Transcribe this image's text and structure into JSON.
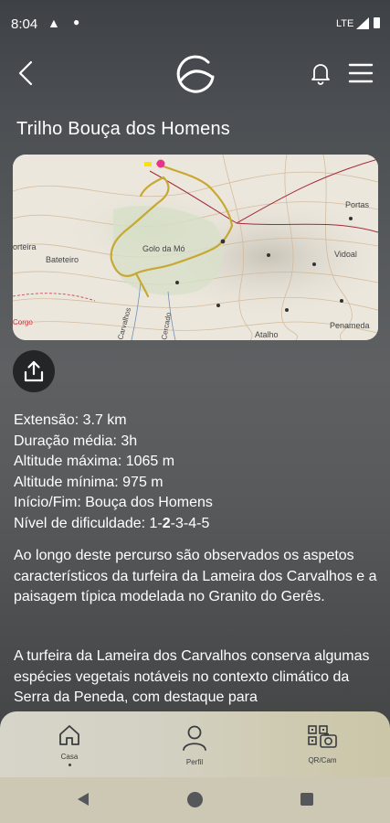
{
  "status_bar": {
    "time": "8:04",
    "network": "LTE"
  },
  "header": {
    "logo_alt": "G logo"
  },
  "trail": {
    "title": "Trilho Bouça dos Homens",
    "map_labels": {
      "golo": "Golo da Mó",
      "bateteiro": "Bateteiro",
      "porteira": "orteira",
      "portas": "Portas",
      "vidoal": "Vidoal",
      "atalho": "Atalho",
      "penameda": "Penameda",
      "corgo": "Corgo",
      "carvalhos": "Carvalhos",
      "cercado": "Cercado"
    },
    "info": [
      "Extensão: 3.7 km",
      "Duração média: 3h",
      "Altitude máxima: 1065 m",
      "Altitude mínima: 975 m",
      "Início/Fim: Bouça dos Homens"
    ],
    "difficulty": {
      "label": "Nível de dificuldade: ",
      "before": "1-",
      "current": "2",
      "after": "-3-4-5"
    },
    "description": [
      "Ao longo deste percurso são observados os aspetos característicos da turfeira da Lameira dos Carvalhos e a paisagem típica modelada no Granito do Gerês.",
      "A turfeira da Lameira dos Carvalhos conserva algumas espécies vegetais notáveis no contexto climático da Serra da Peneda, com destaque para"
    ]
  },
  "bottom_nav": {
    "home": "Casa",
    "profile": "Perfil",
    "qr": "QR/Cam"
  },
  "colors": {
    "accent": "#ffffff",
    "nav_bg": "#d3d1c3",
    "route": "#c8a832"
  }
}
